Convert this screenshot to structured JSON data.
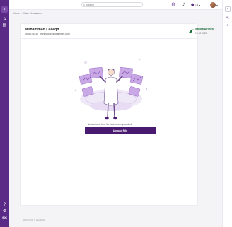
{
  "topbar": {
    "search_placeholder": "Search",
    "language": "EN"
  },
  "breadcrumb": {
    "items": [
      "Home",
      "Voice of customer"
    ]
  },
  "customer": {
    "name": "Muhammad Laeeqh",
    "phone": "0565675436",
    "email": "mohmad@saudiairlines.com"
  },
  "airline": {
    "name": "Saudia Airlines",
    "date": "12.12.2021"
  },
  "main": {
    "empty_message": "No audio or text file has been uploaded",
    "upload_label": "Upload File"
  },
  "footer": {
    "copyright": "2023 VOC © Veri 2023"
  },
  "sidebar": {
    "logo_text": "90C"
  },
  "colors": {
    "brand": "#5b2a86",
    "button": "#4a1a70",
    "airline_green": "#1a6b3a"
  },
  "icons": {
    "sidebar": [
      "expand-icon",
      "home-icon",
      "document-icon",
      "help-icon",
      "gear-icon"
    ],
    "rightrail": [
      "collapse-icon",
      "pen-icon",
      "search-icon"
    ],
    "topbar": [
      "search-icon",
      "headset-icon",
      "bell-icon",
      "globe-icon",
      "chevron-down-icon"
    ]
  }
}
